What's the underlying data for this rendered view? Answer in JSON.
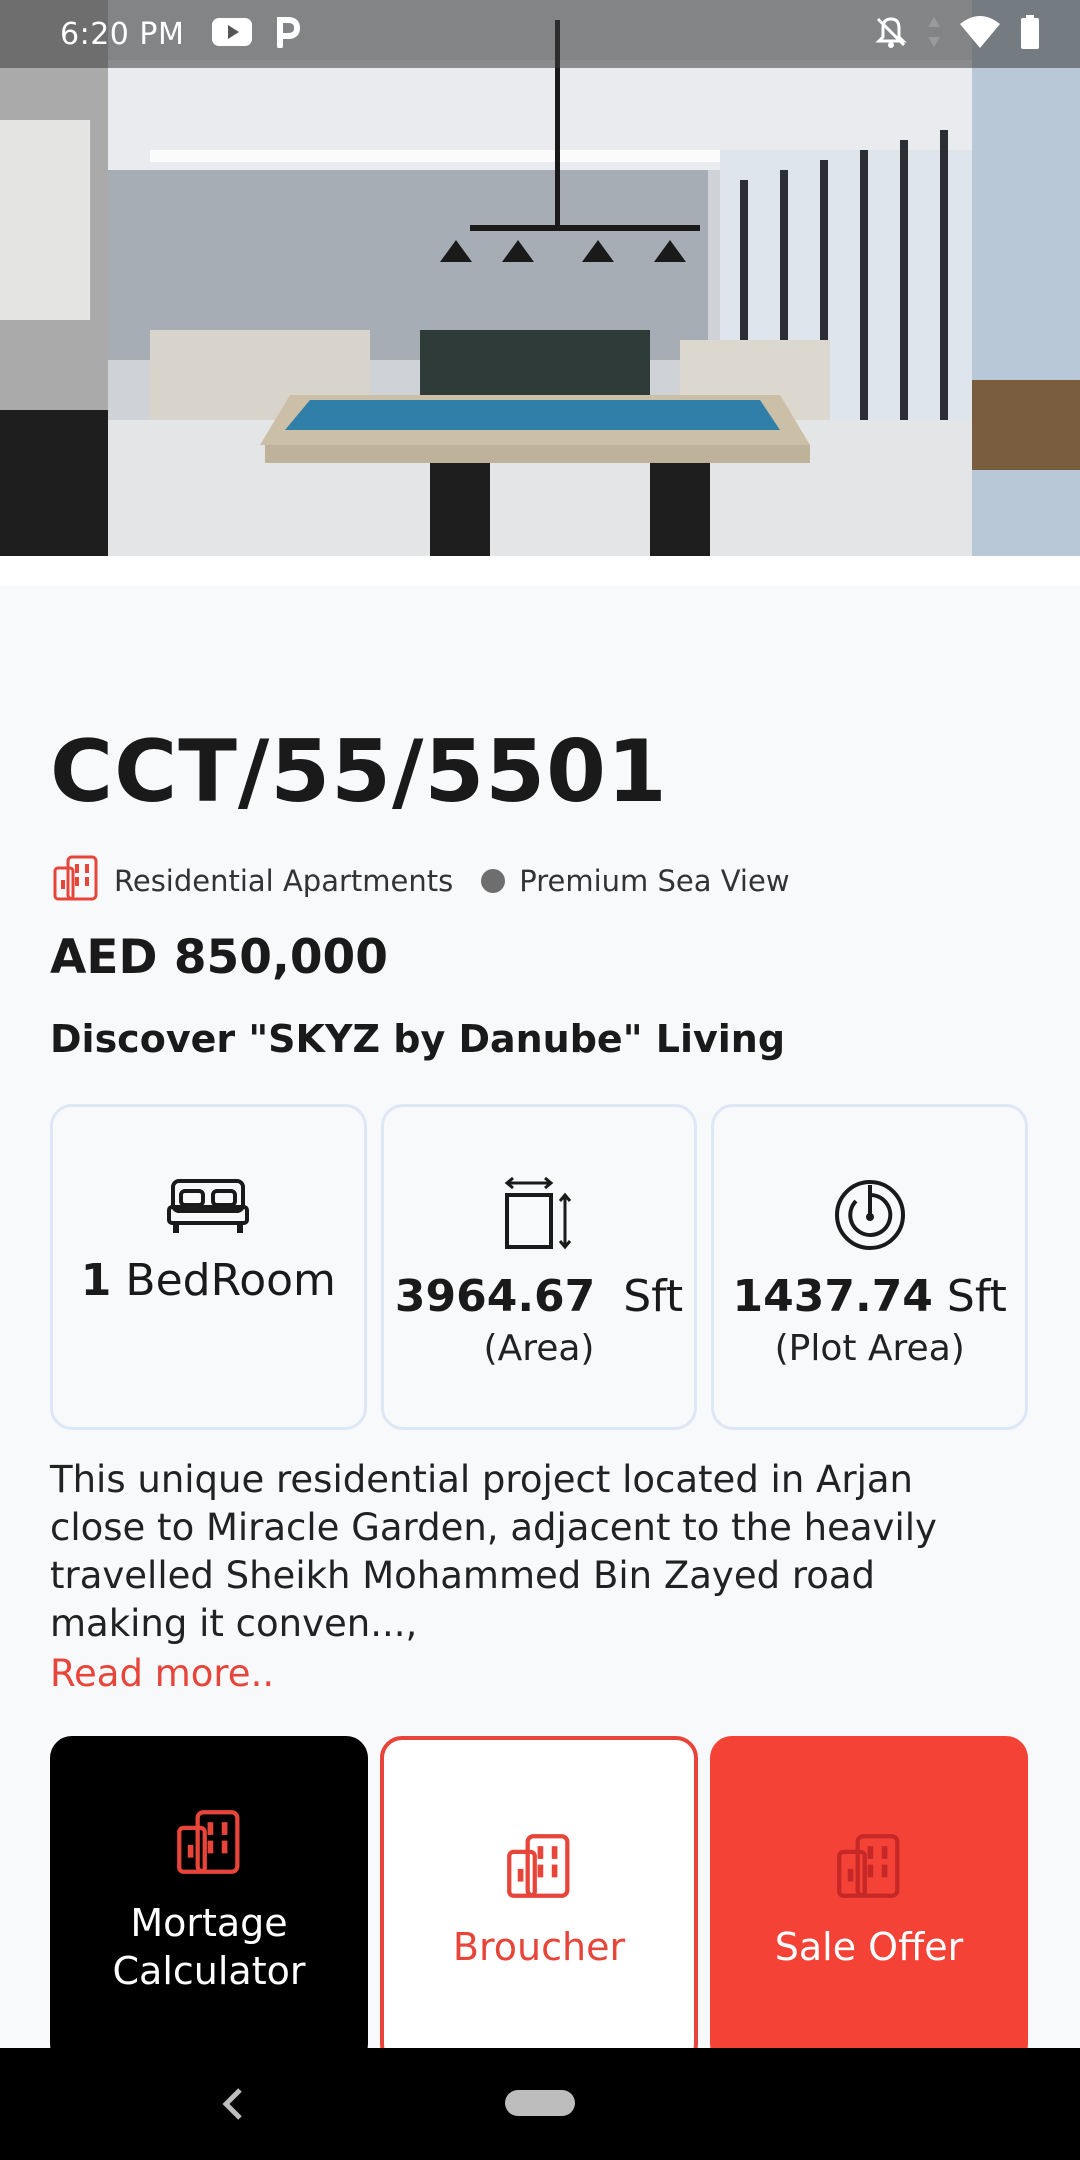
{
  "status_bar": {
    "time": "6:20 PM",
    "left_icons": [
      "youtube-icon",
      "p-app-icon"
    ],
    "right_icons": [
      "do-not-disturb-icon",
      "data-arrows-icon",
      "wifi-icon",
      "battery-icon"
    ]
  },
  "property": {
    "reference": "CCT/55/5501",
    "category": "Residential Apartments",
    "category_icon": "building-icon",
    "view": "Premium Sea View",
    "price": "AED 850,000",
    "tagline": "Discover \"SKYZ by Danube\" Living"
  },
  "features": [
    {
      "icon": "bed-icon",
      "value": "1",
      "unit": "BedRoom",
      "sub": ""
    },
    {
      "icon": "area-icon",
      "value": "3964.67",
      "unit": "Sft",
      "sub": "(Area)"
    },
    {
      "icon": "plot-area-icon",
      "value": "1437.74",
      "unit": "Sft",
      "sub": "(Plot Area)"
    }
  ],
  "description": "This unique residential project located in Arjan close to Miracle Garden, adjacent to the heavily travelled Sheikh Mohammed Bin Zayed road making it conven...,",
  "read_more": "Read more..",
  "actions": [
    {
      "icon": "building-icon",
      "label": "Mortage Calculator"
    },
    {
      "icon": "building-icon",
      "label": "Broucher"
    },
    {
      "icon": "building-icon",
      "label": "Sale Offer"
    }
  ],
  "colors": {
    "accent": "#e8453a",
    "sale_offer_bg": "#f44336",
    "mortgage_bg": "#000000",
    "card_border": "#dde7f5",
    "background": "#f8f9fb"
  }
}
